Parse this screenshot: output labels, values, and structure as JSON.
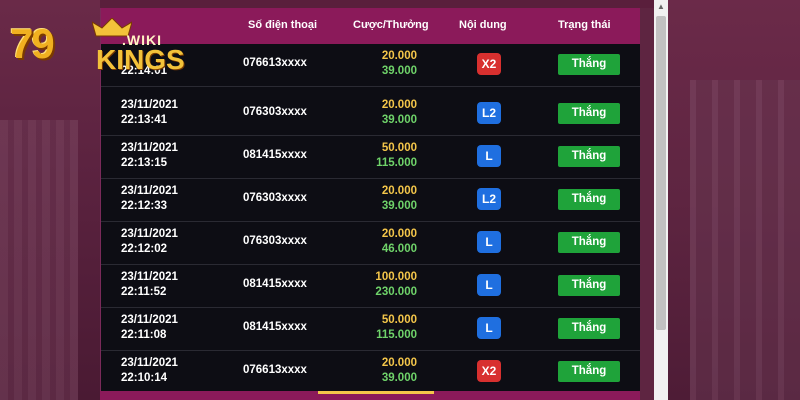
{
  "logo": {
    "number": "79",
    "top": ".WIKI",
    "bottom": "KINGS"
  },
  "header": {
    "phone": "Số điện thoại",
    "bet": "Cược/Thưởng",
    "content": "Nội dung",
    "status": "Trạng thái"
  },
  "rows": [
    {
      "date": "",
      "time": "22:14:01",
      "phone": "076613xxxx",
      "bet": "20.000",
      "win": "39.000",
      "badge": "X2",
      "badge_color": "red",
      "status": "Thắng"
    },
    {
      "date": "23/11/2021",
      "time": "22:13:41",
      "phone": "076303xxxx",
      "bet": "20.000",
      "win": "39.000",
      "badge": "L2",
      "badge_color": "blue",
      "status": "Thắng"
    },
    {
      "date": "23/11/2021",
      "time": "22:13:15",
      "phone": "081415xxxx",
      "bet": "50.000",
      "win": "115.000",
      "badge": "L",
      "badge_color": "blue",
      "status": "Thắng"
    },
    {
      "date": "23/11/2021",
      "time": "22:12:33",
      "phone": "076303xxxx",
      "bet": "20.000",
      "win": "39.000",
      "badge": "L2",
      "badge_color": "blue",
      "status": "Thắng"
    },
    {
      "date": "23/11/2021",
      "time": "22:12:02",
      "phone": "076303xxxx",
      "bet": "20.000",
      "win": "46.000",
      "badge": "L",
      "badge_color": "blue",
      "status": "Thắng"
    },
    {
      "date": "23/11/2021",
      "time": "22:11:52",
      "phone": "081415xxxx",
      "bet": "100.000",
      "win": "230.000",
      "badge": "L",
      "badge_color": "blue",
      "status": "Thắng"
    },
    {
      "date": "23/11/2021",
      "time": "22:11:08",
      "phone": "081415xxxx",
      "bet": "50.000",
      "win": "115.000",
      "badge": "L",
      "badge_color": "blue",
      "status": "Thắng"
    },
    {
      "date": "23/11/2021",
      "time": "22:10:14",
      "phone": "076613xxxx",
      "bet": "20.000",
      "win": "39.000",
      "badge": "X2",
      "badge_color": "red",
      "status": "Thắng"
    }
  ],
  "colors": {
    "header_bg": "#8b1a5a",
    "panel_bg": "#0d0d14",
    "bet_color": "#f4c64a",
    "win_color": "#6fd36a",
    "status_bg": "#1fa33a",
    "badge_red": "#d8302f",
    "badge_blue": "#1f6fe0"
  }
}
